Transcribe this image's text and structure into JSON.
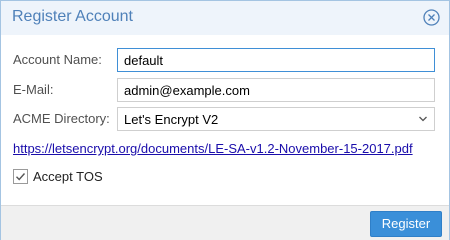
{
  "window": {
    "title": "Register Account"
  },
  "form": {
    "account_name": {
      "label": "Account Name:",
      "value": "default"
    },
    "email": {
      "label": "E-Mail:",
      "value": "admin@example.com"
    },
    "acme_directory": {
      "label": "ACME Directory:",
      "value": "Let's Encrypt V2"
    }
  },
  "tos_link": "https://letsencrypt.org/documents/LE-SA-v1.2-November-15-2017.pdf",
  "accept_tos": {
    "label": "Accept TOS",
    "checked": true
  },
  "footer": {
    "register_label": "Register"
  },
  "colors": {
    "accent": "#3a8fd9",
    "title": "#4f81b9",
    "link": "#1a0dab"
  },
  "icons": {
    "close": "close-circle-icon",
    "dropdown": "chevron-down-icon",
    "check": "checkmark-icon"
  }
}
